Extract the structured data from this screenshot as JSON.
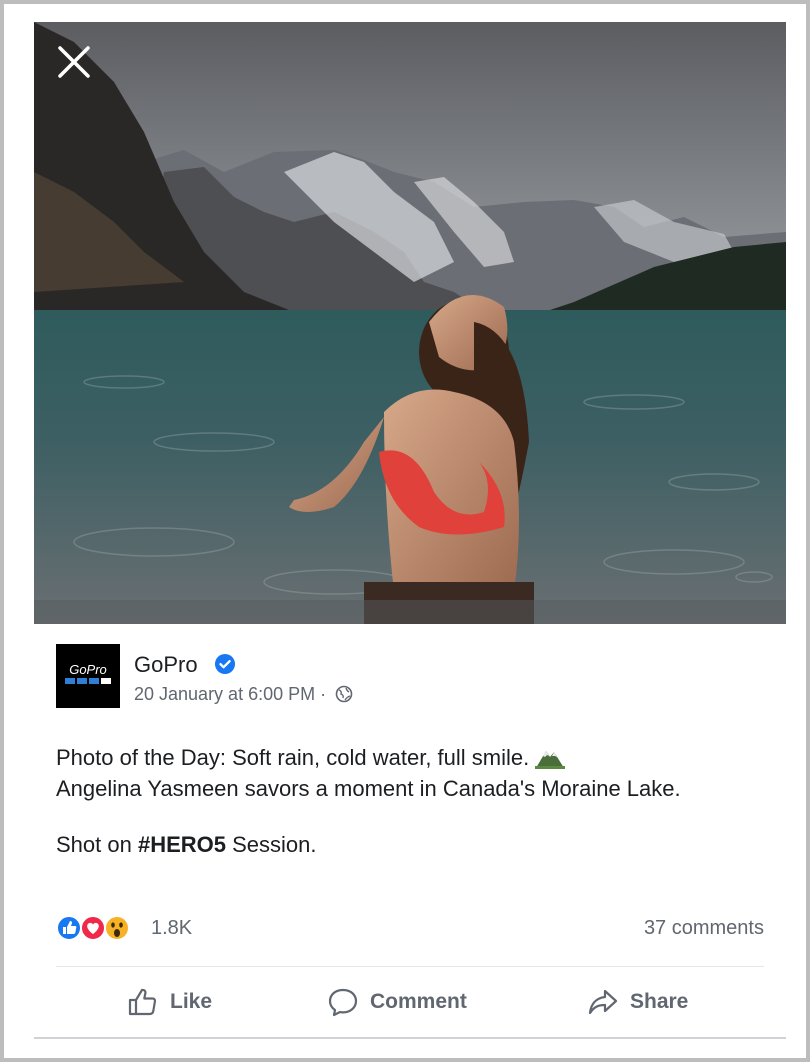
{
  "post": {
    "page_name": "GoPro",
    "verified_icon": "verified-check-icon",
    "timestamp": "20 January at 6:00 PM",
    "separator": "·",
    "privacy_icon": "globe-icon",
    "caption_line1": "Photo of the Day: Soft rain, cold water, full smile.",
    "caption_line2": "Angelina Yasmeen savors a moment in Canada's Moraine Lake.",
    "shot_prefix": "Shot on ",
    "hashtag": "#HERO5",
    "shot_suffix": " Session.",
    "avatar_logo": "GoPro"
  },
  "engagement": {
    "reaction_icons": [
      "like-icon",
      "love-icon",
      "wow-icon"
    ],
    "reactions_count": "1.8K",
    "comments_label": "37 comments"
  },
  "actions": {
    "like_label": "Like",
    "comment_label": "Comment",
    "share_label": "Share"
  },
  "colors": {
    "facebook_blue": "#1877f2",
    "love_red": "#f02849",
    "wow_yellow": "#f7b125",
    "secondary_text": "#606770"
  }
}
